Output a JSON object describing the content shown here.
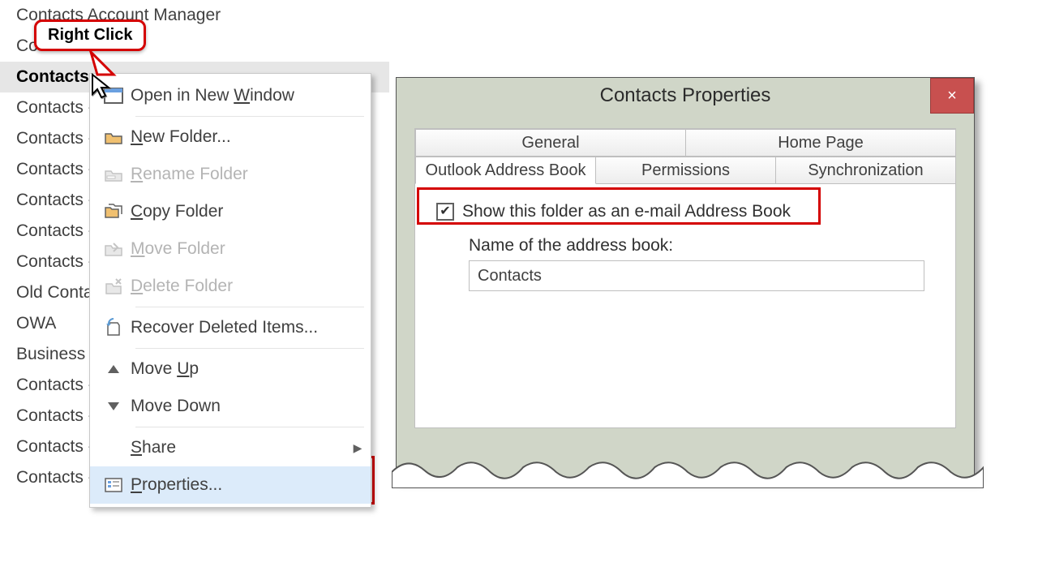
{
  "folder_list": {
    "items": [
      {
        "label": "Contacts   Account Manager",
        "highlighted": false
      },
      {
        "label": "Co",
        "highlighted": false
      },
      {
        "label": "Contacts",
        "highlighted": true
      },
      {
        "label": "Contacts -",
        "highlighted": false
      },
      {
        "label": "Contacts -",
        "highlighted": false
      },
      {
        "label": "Contacts -",
        "highlighted": false
      },
      {
        "label": "Contacts -",
        "highlighted": false
      },
      {
        "label": "Contacts -",
        "highlighted": false
      },
      {
        "label": "Contacts -",
        "highlighted": false
      },
      {
        "label": "Old Conta",
        "highlighted": false
      },
      {
        "label": "OWA",
        "highlighted": false
      },
      {
        "label": "Business c",
        "highlighted": false
      },
      {
        "label": "Contacts -",
        "highlighted": false
      },
      {
        "label": "Contacts -",
        "highlighted": false
      },
      {
        "label": "Contacts -",
        "highlighted": false
      },
      {
        "label": "Contacts -",
        "highlighted": false
      }
    ]
  },
  "callout": {
    "text": "Right Click"
  },
  "context_menu": {
    "items": [
      {
        "icon": "window",
        "label": "Open in New Window",
        "disabled": false,
        "u": 12
      },
      {
        "icon": "folder",
        "label": "New Folder...",
        "disabled": false,
        "u": 0
      },
      {
        "icon": "rename",
        "label": "Rename Folder",
        "disabled": true,
        "u": 0
      },
      {
        "icon": "copy",
        "label": "Copy Folder",
        "disabled": false,
        "u": 0
      },
      {
        "icon": "move",
        "label": "Move Folder",
        "disabled": true,
        "u": 0
      },
      {
        "icon": "delete",
        "label": "Delete Folder",
        "disabled": true,
        "u": 0
      },
      {
        "icon": "recover",
        "label": "Recover Deleted Items...",
        "disabled": false,
        "u": -1
      },
      {
        "icon": "up",
        "label": "Move Up",
        "disabled": false,
        "u": 5
      },
      {
        "icon": "down",
        "label": "Move Down",
        "disabled": false,
        "u": -1
      },
      {
        "icon": "",
        "label": "Share",
        "disabled": false,
        "u": 0,
        "submenu": true
      },
      {
        "icon": "props",
        "label": "Properties...",
        "disabled": false,
        "u": 0,
        "hovered": true
      }
    ],
    "separators_after": [
      0,
      5,
      6,
      8
    ]
  },
  "dialog": {
    "title": "Contacts Properties",
    "close": "×",
    "tabs_row1": [
      "General",
      "Home Page"
    ],
    "tabs_row2": [
      "Outlook Address Book",
      "Permissions",
      "Synchronization"
    ],
    "active_tab": "Outlook Address Book",
    "checkbox_checked": true,
    "checkbox_label": "Show this folder as an e-mail Address Book",
    "name_label": "Name of the address book:",
    "name_value": "Contacts"
  }
}
